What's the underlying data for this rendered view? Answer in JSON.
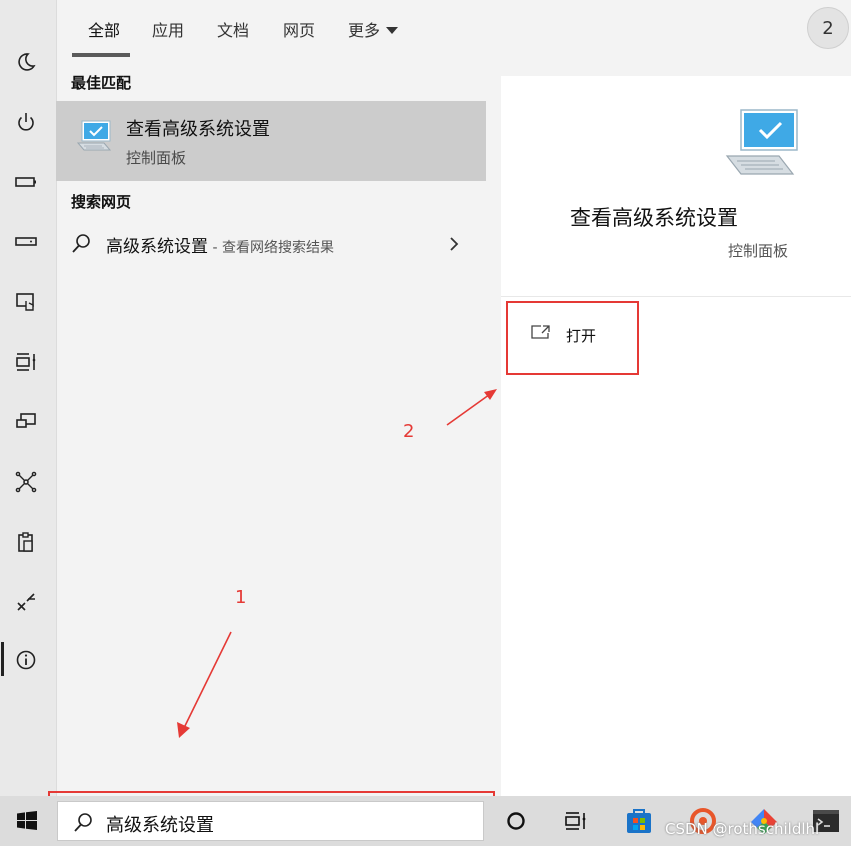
{
  "tabs": {
    "items": [
      {
        "label": "全部"
      },
      {
        "label": "应用"
      },
      {
        "label": "文档"
      },
      {
        "label": "网页"
      },
      {
        "label": "更多"
      }
    ],
    "active_index": 0,
    "account_badge": "2"
  },
  "left_rail": {
    "icons": [
      "moon-icon",
      "power-icon",
      "battery-icon",
      "drive-icon",
      "touch-screen-icon",
      "task-view-icon",
      "display-icon",
      "network-icon",
      "clipboard-icon",
      "remote-icon",
      "info-icon"
    ]
  },
  "results": {
    "best_match_header": "最佳匹配",
    "best_match": {
      "title": "查看高级系统设置",
      "subtitle": "控制面板",
      "icon": "system-settings-icon"
    },
    "web_header": "搜索网页",
    "web_item": {
      "query": "高级系统设置",
      "suffix": " - 查看网络搜索结果"
    }
  },
  "detail": {
    "title": "查看高级系统设置",
    "subtitle": "控制面板",
    "open_label": "打开",
    "open_icon": "open-external-icon"
  },
  "annotations": {
    "step1": "1",
    "step2": "2",
    "color": "#e53935"
  },
  "taskbar": {
    "search_value": "高级系统设置",
    "watermark": "CSDN @rothschildlhl",
    "icons": [
      "windows-start-icon",
      "cortana-icon",
      "task-view-icon",
      "store-icon",
      "app-orange-icon",
      "app-colorful-icon",
      "terminal-icon"
    ]
  }
}
